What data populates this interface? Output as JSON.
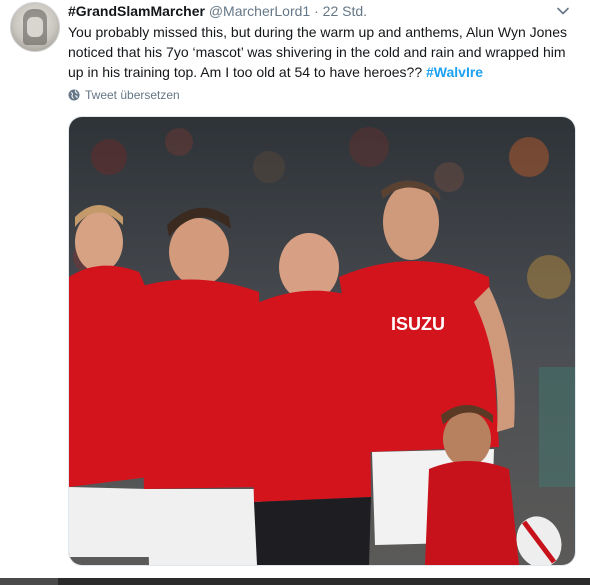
{
  "tweet": {
    "display_name": "#GrandSlamMarcher",
    "handle": "@MarcherLord1",
    "separator": "·",
    "time": "22 Std.",
    "text": "You probably missed this, but during the warm up and anthems,  Alun Wyn Jones noticed that his 7yo ‘mascot’ was shivering in the cold and rain and wrapped him up in his training top. Am I too old at 54 to have heroes??",
    "hashtag": "#WalvIre",
    "translate_label": "Tweet übersetzen"
  },
  "photo": {
    "jersey_sponsor": "ISUZU",
    "colors": {
      "jersey": "#d4141d",
      "crowd": "#3a3f45",
      "shorts": "#f2f2f2"
    }
  },
  "icons": [
    "avatar",
    "chevron-down-icon",
    "globe-icon"
  ],
  "colors": {
    "accent": "#1da1f2",
    "text": "#14171a",
    "muted": "#657786"
  }
}
